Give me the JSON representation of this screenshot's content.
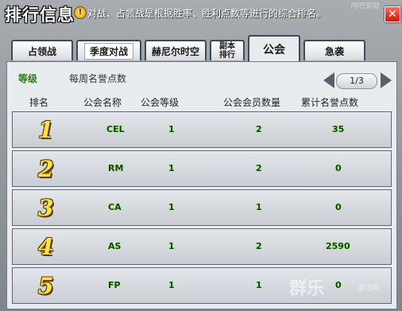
{
  "window": {
    "title": "排行信息",
    "description": "对战、占领战是根据胜率、胜利点数等进行的综合排名。",
    "corner_text": "网吧奖励",
    "close": "✕"
  },
  "tabs": [
    {
      "label": "占领战"
    },
    {
      "label": "季度对战"
    },
    {
      "label": "赫尼尔时空"
    },
    {
      "label": "副本排行"
    },
    {
      "label": "公会"
    },
    {
      "label": "急袭"
    }
  ],
  "subbar": {
    "level": "等级",
    "weekly": "每周名誉点数",
    "page": "1/3"
  },
  "columns": [
    "排名",
    "公会名称",
    "公会等级",
    "公会会员数量",
    "累计名誉点数"
  ],
  "rows": [
    {
      "rank": "1",
      "name": "CEL",
      "level": "1",
      "members": "2",
      "points": "35"
    },
    {
      "rank": "2",
      "name": "RM",
      "level": "1",
      "members": "2",
      "points": "0"
    },
    {
      "rank": "3",
      "name": "CA",
      "level": "1",
      "members": "1",
      "points": "0"
    },
    {
      "rank": "4",
      "name": "AS",
      "level": "1",
      "members": "2",
      "points": "2590"
    },
    {
      "rank": "5",
      "name": "FP",
      "level": "1",
      "members": "1",
      "points": "0"
    }
  ],
  "watermark": {
    "main": "群乐",
    "sub": "游戏网"
  }
}
